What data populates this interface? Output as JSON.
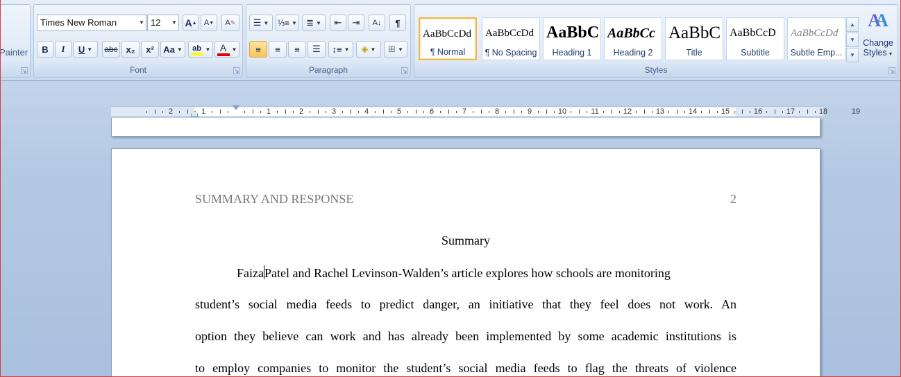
{
  "clipboard": {
    "painter_label": "Painter"
  },
  "font_group": {
    "label": "Font",
    "font_name": "Times New Roman",
    "font_size": "12",
    "bold": "B",
    "italic": "I",
    "underline": "U",
    "strike": "abc",
    "subscript": "x₂",
    "superscript": "x²",
    "change_case": "Aa",
    "grow": "A",
    "shrink": "A",
    "clear": "A",
    "font_color": "A",
    "highlight": "ab",
    "highlight_color": "#ffff00",
    "font_color_bar": "#e00000"
  },
  "paragraph_group": {
    "label": "Paragraph"
  },
  "styles_group": {
    "label": "Styles",
    "tiles": [
      {
        "sample": "AaBbCcDd",
        "name": "¶ Normal"
      },
      {
        "sample": "AaBbCcDd",
        "name": "¶ No Spacing"
      },
      {
        "sample": "AaBbC",
        "name": "Heading 1"
      },
      {
        "sample": "AaBbCc",
        "name": "Heading 2"
      },
      {
        "sample": "AaBbC",
        "name": "Title"
      },
      {
        "sample": "AaBbCcD",
        "name": "Subtitle"
      },
      {
        "sample": "AaBbCcDd",
        "name": "Subtle Emp..."
      }
    ],
    "change_styles_line1": "Change",
    "change_styles_line2": "Styles"
  },
  "ruler": {
    "numbers": [
      "2",
      "1",
      "1",
      "2",
      "3",
      "4",
      "5",
      "6",
      "7",
      "8",
      "9",
      "10",
      "11",
      "12",
      "13",
      "14",
      "15",
      "16",
      "17",
      "18",
      "19"
    ]
  },
  "document": {
    "header_text": "SUMMARY AND RESPONSE",
    "page_number": "2",
    "heading": "Summary",
    "line1_before_cursor": "Faiza",
    "line1_after_cursor": "Patel and Rachel Levinson-Walden’s article explores how schools are monitoring",
    "line2": "student’s social media feeds to predict danger, an initiative that they feel does not work. An",
    "line3": "option they believe can work and has already been implemented by some academic institutions is",
    "line4": "to employ companies to monitor the student’s social media feeds to flag the threats of violence"
  }
}
